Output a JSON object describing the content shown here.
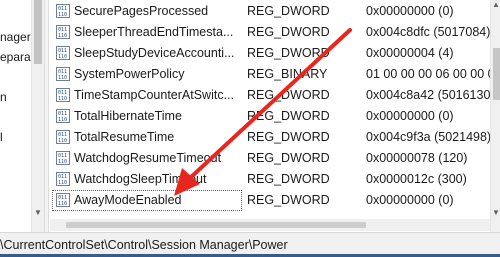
{
  "tree": {
    "items": [
      {
        "label": "nager"
      },
      {
        "label": "epara"
      },
      {
        "label": "n"
      },
      {
        "label": "l"
      }
    ]
  },
  "values": {
    "rows": [
      {
        "name": "SecurePagesProcessed",
        "type": "REG_DWORD",
        "data": "0x00000000 (0)",
        "icon": "reg-binary-icon"
      },
      {
        "name": "SleeperThreadEndTimesta...",
        "type": "REG_DWORD",
        "data": "0x004c8dfc (5017084)",
        "icon": "reg-binary-icon"
      },
      {
        "name": "SleepStudyDeviceAccounti...",
        "type": "REG_DWORD",
        "data": "0x00000004 (4)",
        "icon": "reg-binary-icon"
      },
      {
        "name": "SystemPowerPolicy",
        "type": "REG_BINARY",
        "data": "01 00 00 00 06 00 00 0",
        "icon": "reg-binary-icon"
      },
      {
        "name": "TimeStampCounterAtSwitc...",
        "type": "REG_DWORD",
        "data": "0x004c8a42 (5016130)",
        "icon": "reg-binary-icon"
      },
      {
        "name": "TotalHibernateTime",
        "type": "REG_DWORD",
        "data": "0x00000000 (0)",
        "icon": "reg-binary-icon"
      },
      {
        "name": "TotalResumeTime",
        "type": "REG_DWORD",
        "data": "0x004c9f3a (5021498)",
        "icon": "reg-binary-icon"
      },
      {
        "name": "WatchdogResumeTimeout",
        "type": "REG_DWORD",
        "data": "0x00000078 (120)",
        "icon": "reg-binary-icon"
      },
      {
        "name": "WatchdogSleepTimeout",
        "type": "REG_DWORD",
        "data": "0x0000012c (300)",
        "icon": "reg-binary-icon"
      },
      {
        "name": "AwayModeEnabled",
        "type": "REG_DWORD",
        "data": "0x00000000 (0)",
        "icon": "reg-binary-icon",
        "selected": true
      }
    ]
  },
  "statusbar": {
    "path": "\\CurrentControlSet\\Control\\Session Manager\\Power"
  },
  "annotation": {
    "color": "#e8261d"
  }
}
